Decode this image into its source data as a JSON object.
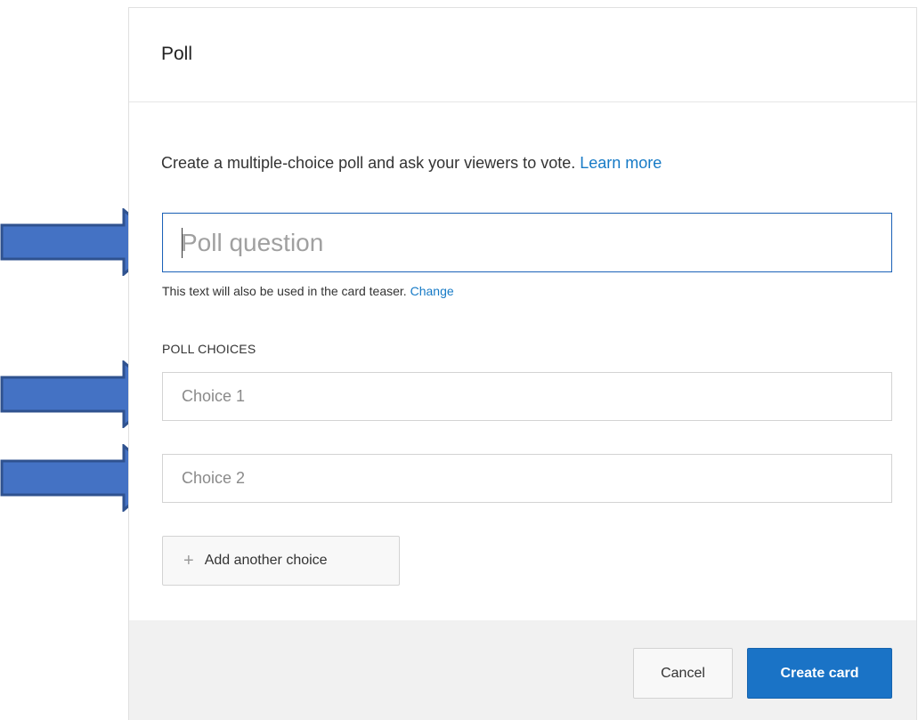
{
  "dialog": {
    "title": "Poll",
    "description": "Create a multiple-choice poll and ask your viewers to vote.",
    "learn_more": "Learn more"
  },
  "question": {
    "placeholder": "Poll question",
    "hint": "This text will also be used in the card teaser.",
    "change_link": "Change"
  },
  "choices": {
    "section_label": "POLL CHOICES",
    "items": [
      {
        "placeholder": "Choice 1"
      },
      {
        "placeholder": "Choice 2"
      }
    ],
    "add_label": "Add another choice",
    "add_icon": "plus-icon"
  },
  "footer": {
    "cancel_label": "Cancel",
    "create_label": "Create card"
  },
  "annotations": {
    "arrow_icon": "right-arrow-icon",
    "arrow_color": "#4472c4",
    "arrow_outline": "#2f528f"
  },
  "colors": {
    "accent": "#1a73c6",
    "link": "#167ac6",
    "focus_border": "#1c62b9",
    "footer_bg": "#f1f1f1"
  }
}
